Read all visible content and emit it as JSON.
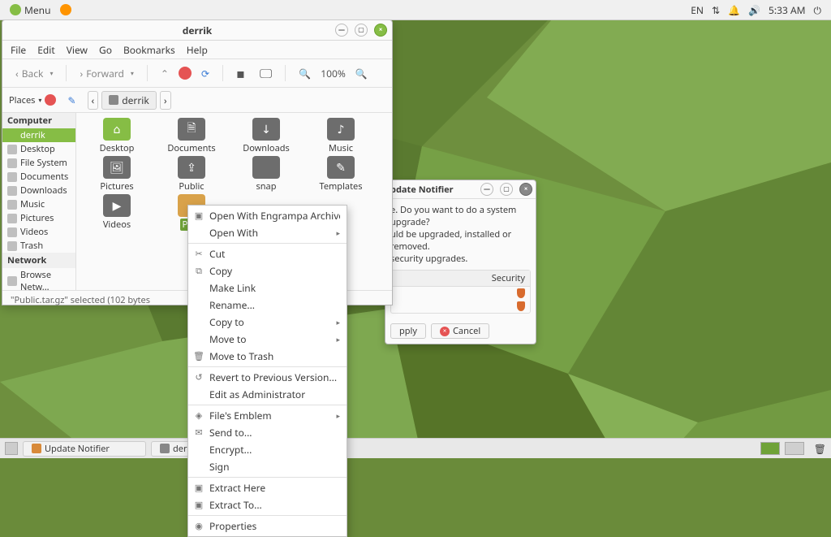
{
  "panel": {
    "menu_label": "Menu",
    "lang": "EN",
    "time": "5:33 AM"
  },
  "fm": {
    "title": "derrik",
    "menubar": [
      "File",
      "Edit",
      "View",
      "Go",
      "Bookmarks",
      "Help"
    ],
    "back": "Back",
    "forward": "Forward",
    "zoom": "100%",
    "places_label": "Places",
    "breadcrumb": "derrik",
    "side_computer_hdr": "Computer",
    "side_network_hdr": "Network",
    "side_items": [
      "derrik",
      "Desktop",
      "File System",
      "Documents",
      "Downloads",
      "Music",
      "Pictures",
      "Videos",
      "Trash"
    ],
    "side_network": [
      "Browse Netw..."
    ],
    "files": [
      {
        "label": "Desktop",
        "ic": "green"
      },
      {
        "label": "Documents",
        "ic": ""
      },
      {
        "label": "Downloads",
        "ic": ""
      },
      {
        "label": "Music",
        "ic": ""
      },
      {
        "label": "Pictures",
        "ic": ""
      },
      {
        "label": "Public",
        "ic": ""
      },
      {
        "label": "snap",
        "ic": ""
      },
      {
        "label": "Templates",
        "ic": ""
      },
      {
        "label": "Videos",
        "ic": ""
      },
      {
        "label": "Publ",
        "ic": "sel"
      }
    ],
    "status": "\"Public.tar.gz\" selected (102 bytes"
  },
  "ctx": {
    "items": [
      "Open With Engrampa Archive Manager",
      "Open With",
      "Cut",
      "Copy",
      "Make Link",
      "Rename...",
      "Copy to",
      "Move to",
      "Move to Trash",
      "Revert to Previous Version...",
      "Edit as Administrator",
      "File's Emblem",
      "Send to...",
      "Encrypt...",
      "Sign",
      "Extract Here",
      "Extract To...",
      "Properties"
    ]
  },
  "upd": {
    "title": "pdate Notifier",
    "msg1": "e. Do you want to do a system upgrade?",
    "msg2": "uld be upgraded, installed or removed.",
    "msg3": "security upgrades.",
    "col": "Security",
    "apply": "pply",
    "cancel": "Cancel"
  },
  "taskbar": {
    "tasks": [
      "Update Notifier",
      "derrik"
    ]
  }
}
